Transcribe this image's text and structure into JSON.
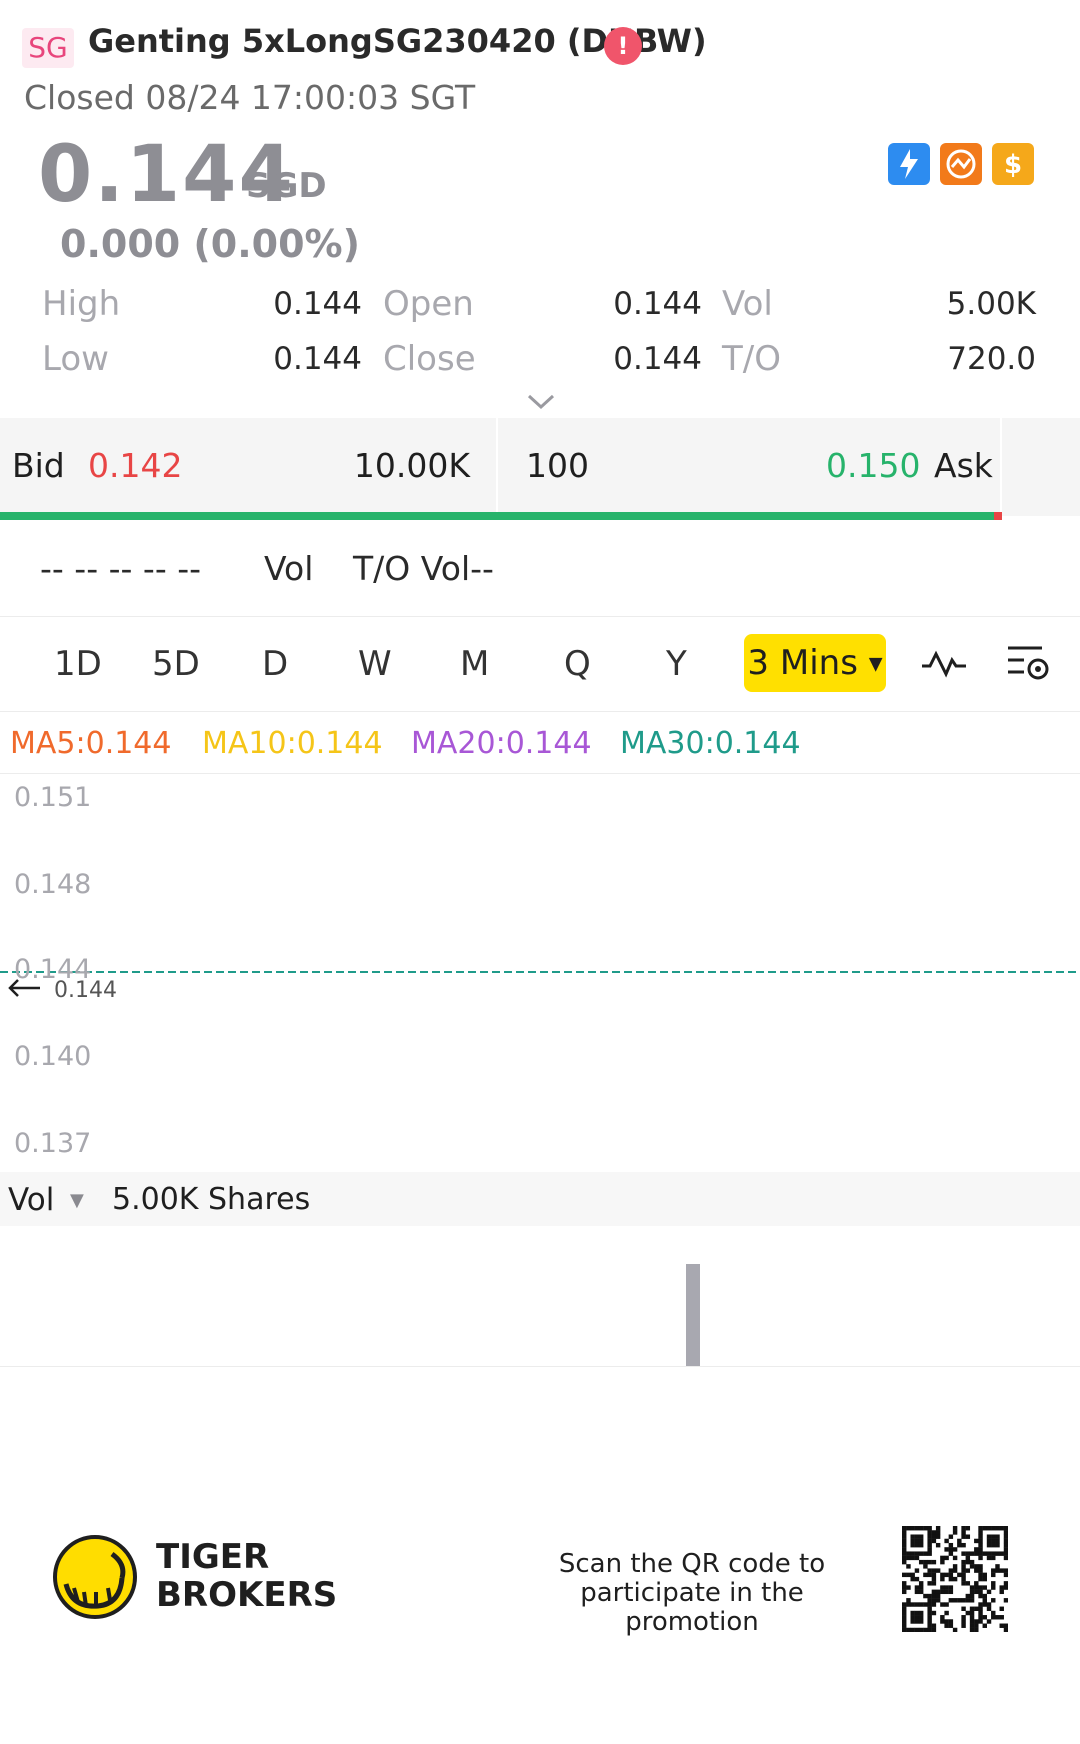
{
  "header": {
    "market_badge": "SG",
    "title": "Genting 5xLongSG230420 (DUBW)",
    "alert_symbol": "!",
    "status": "Closed 08/24 17:00:03 SGT"
  },
  "quote": {
    "price": "0.144",
    "currency": "SGD",
    "change": "0.000 (0.00%)"
  },
  "stats": {
    "high_label": "High",
    "high_value": "0.144",
    "open_label": "Open",
    "open_value": "0.144",
    "vol_label": "Vol",
    "vol_value": "5.00K",
    "low_label": "Low",
    "low_value": "0.144",
    "close_label": "Close",
    "close_value": "0.144",
    "to_label": "T/O",
    "to_value": "720.0"
  },
  "orderbook": {
    "bid_label": "Bid",
    "bid_price": "0.142",
    "bid_size": "10.00K",
    "ask_size": "100",
    "ask_price": "0.150",
    "ask_label": "Ask",
    "dashes": "-- -- -- -- --",
    "vol_label": "Vol",
    "to_vol_label": "T/O Vol--"
  },
  "tabs": [
    "1D",
    "5D",
    "D",
    "W",
    "M",
    "Q",
    "Y"
  ],
  "active_tab": "3 Mins",
  "ma": {
    "ma5": "MA5:0.144",
    "ma10": "MA10:0.144",
    "ma20": "MA20:0.144",
    "ma30": "MA30:0.144"
  },
  "chart": {
    "y_ticks": [
      "0.151",
      "0.148",
      "0.144",
      "0.140",
      "0.137"
    ],
    "last_price_marker": "0.144",
    "vol_label": "Vol",
    "vol_value": "5.00K Shares"
  },
  "footer": {
    "brand_line1": "TIGER",
    "brand_line2": "BROKERS",
    "promo_line1": "Scan the QR code to",
    "promo_line2": "participate in the promotion"
  },
  "colors": {
    "bid": "#e84545",
    "ask": "#27b36b",
    "ma5": "#f06a2c",
    "ma10": "#f5c518",
    "ma20": "#a857d6",
    "ma30": "#1f9b8a",
    "active_tab": "#ffe000"
  }
}
